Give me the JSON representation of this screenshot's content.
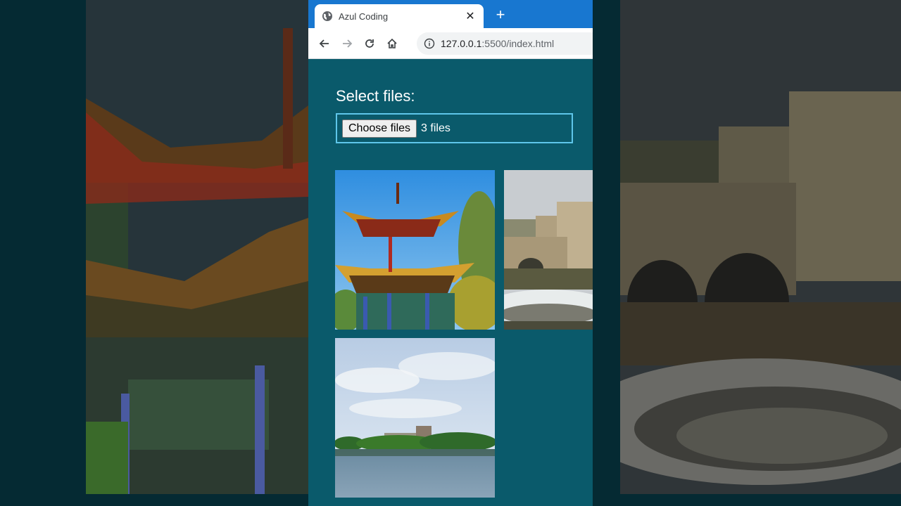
{
  "tab": {
    "title": "Azul Coding",
    "close_glyph": "✕",
    "new_tab_glyph": "+"
  },
  "address": {
    "host": "127.0.0.1",
    "rest": ":5500/index.html"
  },
  "page": {
    "heading": "Select files:",
    "file_input": {
      "button_label": "Choose files",
      "status": "3 files"
    }
  },
  "icons": {
    "globe": "globe-icon",
    "back": "back-arrow-icon",
    "forward": "forward-arrow-icon",
    "reload": "reload-icon",
    "home": "home-icon",
    "info": "info-icon"
  },
  "colors": {
    "tab_strip": "#1877d0",
    "page_bg": "#0a5a6b",
    "input_border": "#5ec6ea"
  }
}
